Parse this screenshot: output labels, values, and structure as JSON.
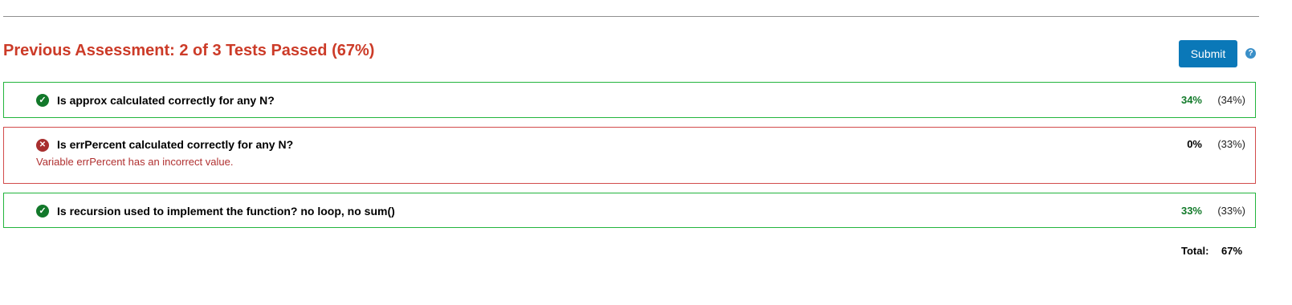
{
  "assessment": {
    "heading": "Previous Assessment: 2 of 3 Tests Passed (67%)",
    "submit_label": "Submit",
    "help_icon": "question-circle-icon",
    "help_glyph": "?"
  },
  "tests": [
    {
      "status": "pass",
      "icon": "check-circle-icon",
      "glyph": "✓",
      "title": "Is approx calculated correctly for any N?",
      "score": "34%",
      "weight": "(34%)"
    },
    {
      "status": "fail",
      "icon": "x-circle-icon",
      "glyph": "✕",
      "title": "Is errPercent calculated correctly for any N?",
      "message": "Variable errPercent has an incorrect value.",
      "score": "0%",
      "weight": "(33%)"
    },
    {
      "status": "pass",
      "icon": "check-circle-icon",
      "glyph": "✓",
      "title": "Is recursion used to implement the function? no loop, no sum()",
      "score": "33%",
      "weight": "(33%)"
    }
  ],
  "total": {
    "label": "Total:",
    "value": "67%"
  },
  "colors": {
    "heading": "#cc3b28",
    "pass_border": "#22b53c",
    "fail_border": "#d24b4b",
    "submit_bg": "#0a78b8"
  }
}
